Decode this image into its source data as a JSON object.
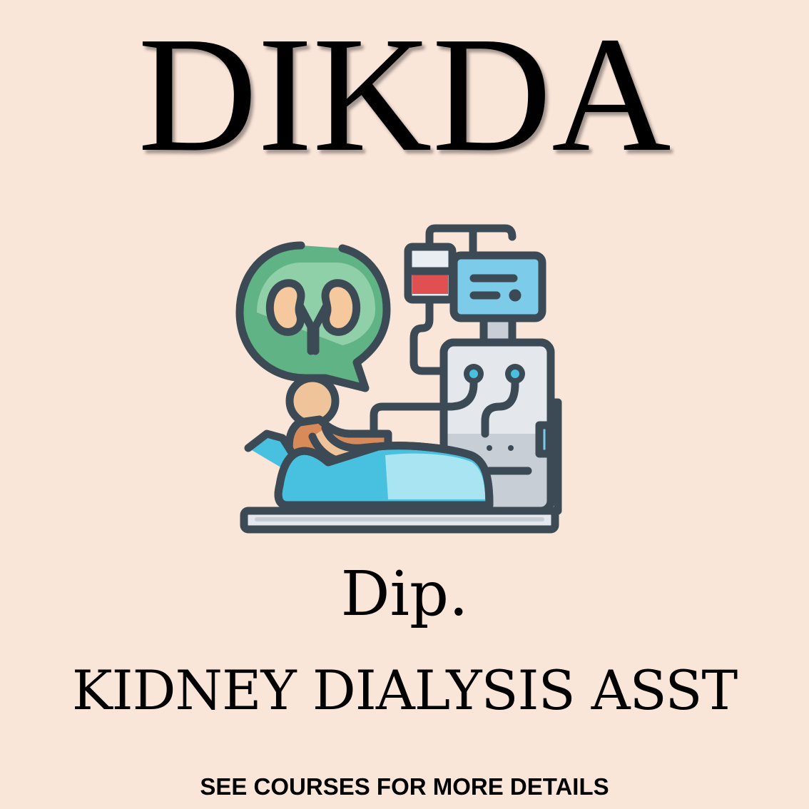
{
  "title": "DIKDA",
  "illustration": {
    "icon": "kidney-dialysis-icon",
    "colors": {
      "outline": "#3c4a55",
      "speech_bubble": "#5fb384",
      "speech_bubble_light": "#8fd0a8",
      "kidney": "#f5c89d",
      "kidney_shade": "#e49a5e",
      "patient_skin": "#f0c49a",
      "patient_body": "#d88a58",
      "blanket": "#48c0e0",
      "blanket_light": "#a8e4f2",
      "machine": "#e4e8ec",
      "machine_shade": "#c7ced6",
      "screen": "#7ccbe8",
      "blood_bag": "#e05050"
    }
  },
  "dip_label": "Dip.",
  "course_name": "KIDNEY DIALYSIS ASST",
  "note": "SEE COURSES FOR MORE DETAILS",
  "colors": {
    "background": "#fae5d9",
    "text": "#000000"
  }
}
